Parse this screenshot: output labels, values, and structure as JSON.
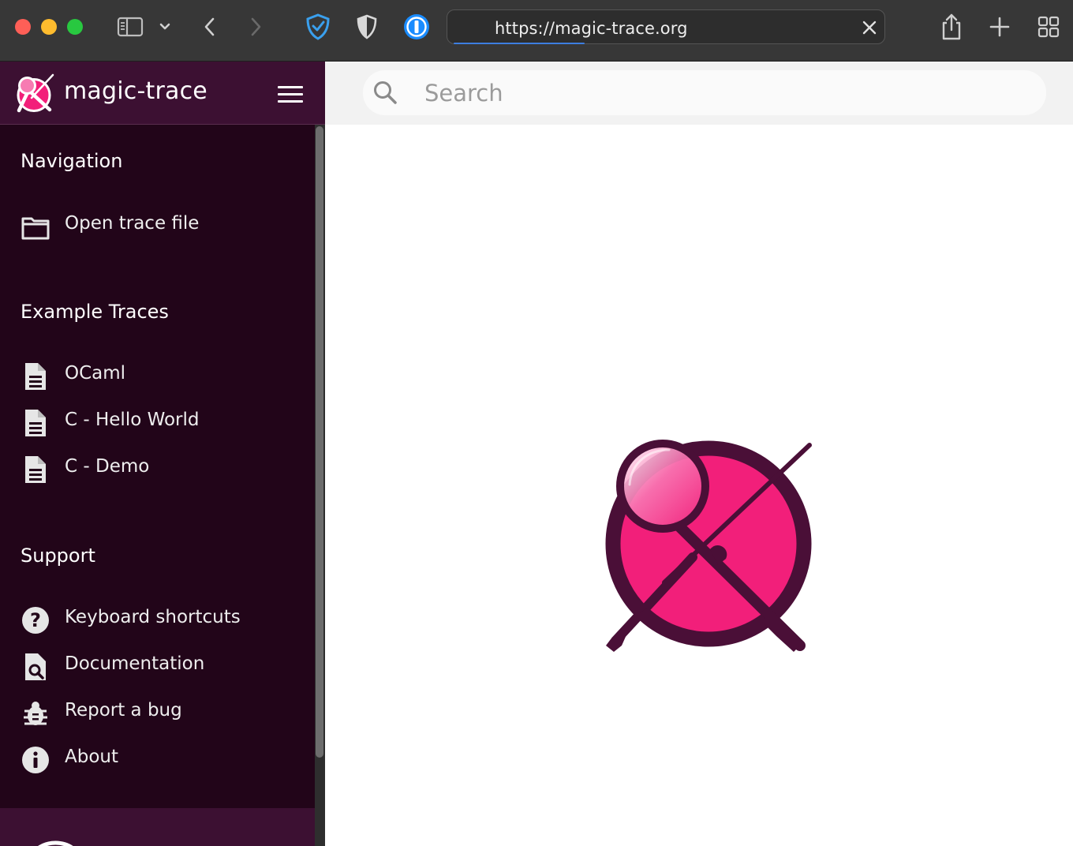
{
  "browser": {
    "url": "https://magic-trace.org",
    "icons": [
      "sidebar-toggle-icon",
      "chevron-down-icon",
      "back-icon",
      "forward-icon",
      "privacy-shield-icon",
      "shield-icon",
      "password-manager-icon",
      "clear-icon",
      "share-icon",
      "new-tab-icon",
      "tab-overview-icon"
    ]
  },
  "app": {
    "name": "magic-trace",
    "colors": {
      "brand_dark": "#3c1032",
      "sidebar_bg": "#220519",
      "accent_pink": "#f21f7a"
    }
  },
  "search": {
    "placeholder": "Search"
  },
  "sidebar": {
    "sections": [
      {
        "title": "Navigation",
        "items": [
          {
            "label": "Open trace file",
            "icon": "folder-icon"
          }
        ]
      },
      {
        "title": "Example Traces",
        "items": [
          {
            "label": "OCaml",
            "icon": "file-icon"
          },
          {
            "label": "C - Hello World",
            "icon": "file-icon"
          },
          {
            "label": "C - Demo",
            "icon": "file-icon"
          }
        ]
      },
      {
        "title": "Support",
        "items": [
          {
            "label": "Keyboard shortcuts",
            "icon": "help-icon"
          },
          {
            "label": "Documentation",
            "icon": "documentation-icon"
          },
          {
            "label": "Report a bug",
            "icon": "bug-icon"
          },
          {
            "label": "About",
            "icon": "info-icon"
          }
        ]
      }
    ]
  }
}
